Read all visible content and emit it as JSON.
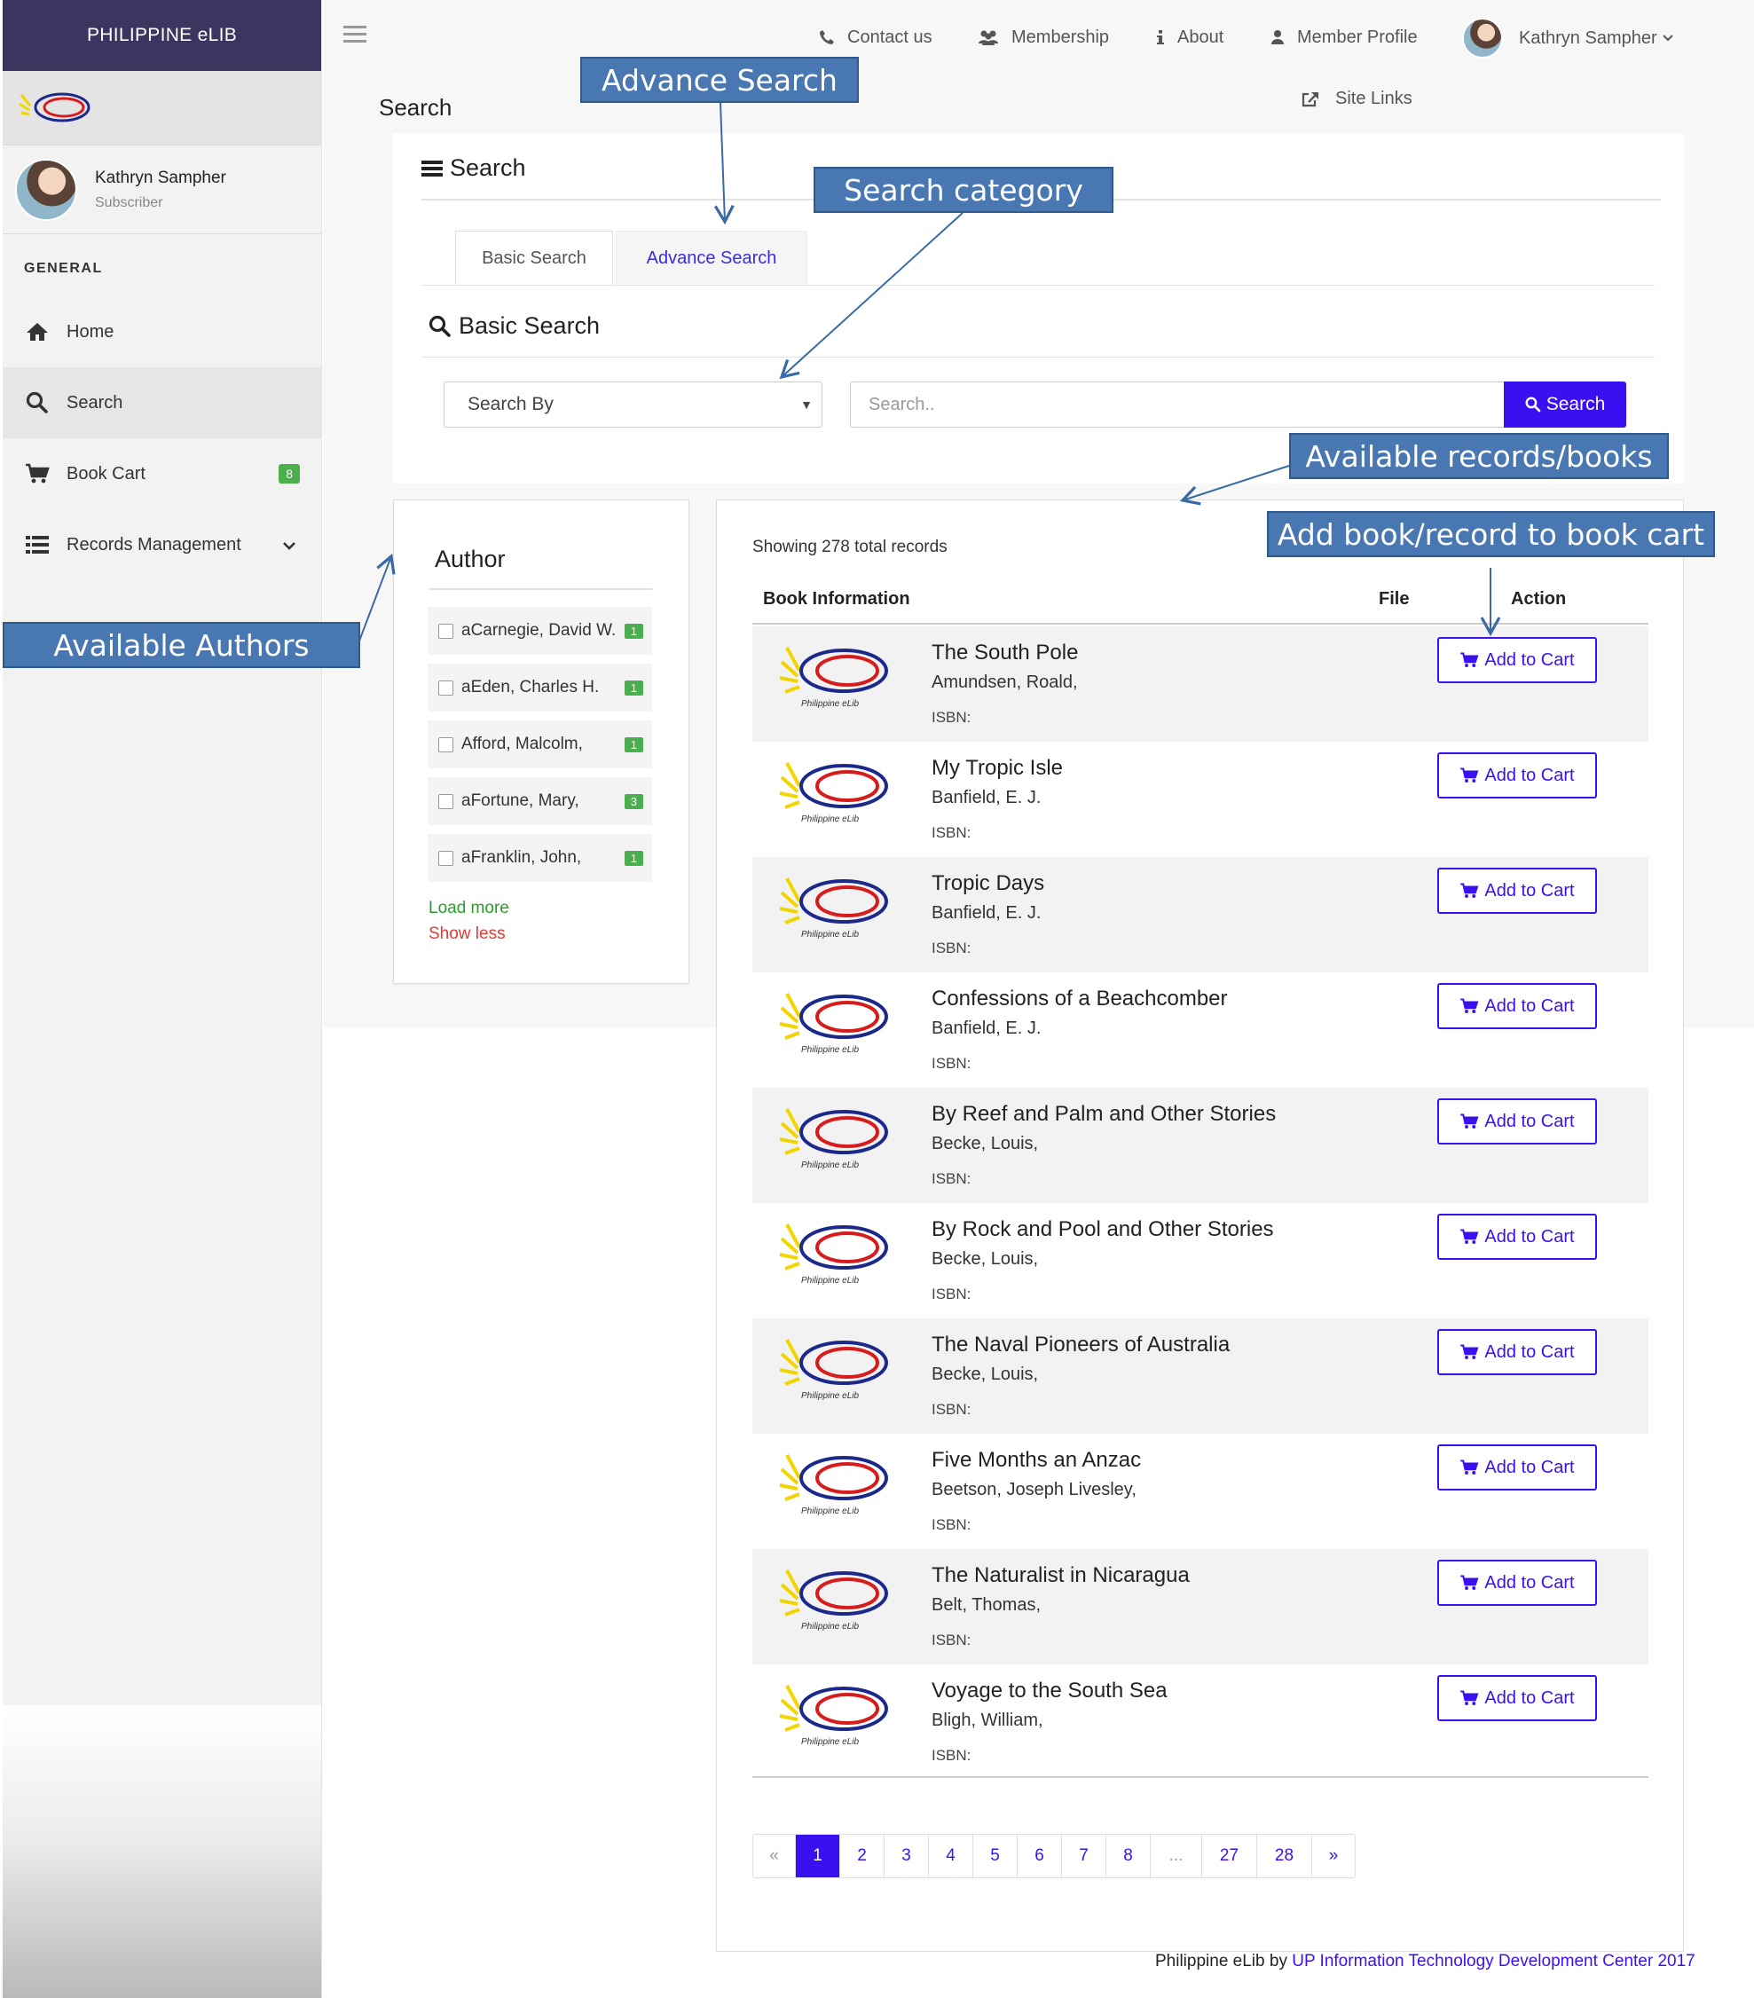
{
  "sidebar": {
    "brand": "PHILIPPINE eLIB",
    "user": {
      "name": "Kathryn Sampher",
      "role": "Subscriber"
    },
    "heading": "GENERAL",
    "items": [
      {
        "label": "Home",
        "icon": "home-icon"
      },
      {
        "label": "Search",
        "icon": "search-icon"
      },
      {
        "label": "Book Cart",
        "icon": "cart-icon",
        "badge": "8"
      },
      {
        "label": "Records Management",
        "icon": "list-icon"
      }
    ]
  },
  "topnav": {
    "contact": "Contact us",
    "membership": "Membership",
    "about": "About",
    "profile": "Member Profile",
    "user": "Kathryn Sampher",
    "site_links": "Site Links"
  },
  "page_title": "Search",
  "search_panel": {
    "title": "Search",
    "tabs": {
      "basic": "Basic Search",
      "advance": "Advance Search"
    },
    "basic_title": "Basic Search",
    "search_by": "Search By",
    "search_placeholder": "Search..",
    "search_button": "Search"
  },
  "author_filter": {
    "title": "Author",
    "items": [
      {
        "name": "aCarnegie, David W.",
        "count": "1"
      },
      {
        "name": "aEden, Charles H.",
        "count": "1"
      },
      {
        "name": "Afford, Malcolm,",
        "count": "1"
      },
      {
        "name": "aFortune, Mary,",
        "count": "3"
      },
      {
        "name": "aFranklin, John,",
        "count": "1"
      }
    ],
    "load_more": "Load more",
    "show_less": "Show less"
  },
  "records": {
    "showing": "Showing 278 total records",
    "headers": {
      "info": "Book Information",
      "file": "File",
      "action": "Action"
    },
    "isbn_label": "ISBN:",
    "cart_label": "Add to Cart",
    "logo_text": "Philippine eLib",
    "items": [
      {
        "title": "The South Pole",
        "author": "Amundsen, Roald,"
      },
      {
        "title": "My Tropic Isle",
        "author": "Banfield, E. J."
      },
      {
        "title": "Tropic Days",
        "author": "Banfield, E. J."
      },
      {
        "title": "Confessions of a Beachcomber",
        "author": "Banfield, E. J."
      },
      {
        "title": "By Reef and Palm and Other Stories",
        "author": "Becke, Louis,"
      },
      {
        "title": "By Rock and Pool and Other Stories",
        "author": "Becke, Louis,"
      },
      {
        "title": "The Naval Pioneers of Australia",
        "author": "Becke, Louis,"
      },
      {
        "title": "Five Months an Anzac",
        "author": "Beetson, Joseph Livesley,"
      },
      {
        "title": "The Naturalist in Nicaragua",
        "author": "Belt, Thomas,"
      },
      {
        "title": "Voyage to the South Sea",
        "author": "Bligh, William,"
      }
    ]
  },
  "pagination": [
    "«",
    "1",
    "2",
    "3",
    "4",
    "5",
    "6",
    "7",
    "8",
    "...",
    "27",
    "28",
    "»"
  ],
  "footer": {
    "prefix": "Philippine eLib by ",
    "link": "UP Information Technology Development Center 2017"
  },
  "annotations": {
    "advance_search": "Advance Search",
    "search_category": "Search category",
    "available_records": "Available records/books",
    "add_to_cart": "Add book/record to book cart",
    "available_authors": "Available Authors"
  },
  "colors": {
    "accent": "#3b10f0",
    "sidebar_brand": "#3b3660",
    "badge": "#4cae4c",
    "callout": "#4877b2"
  }
}
